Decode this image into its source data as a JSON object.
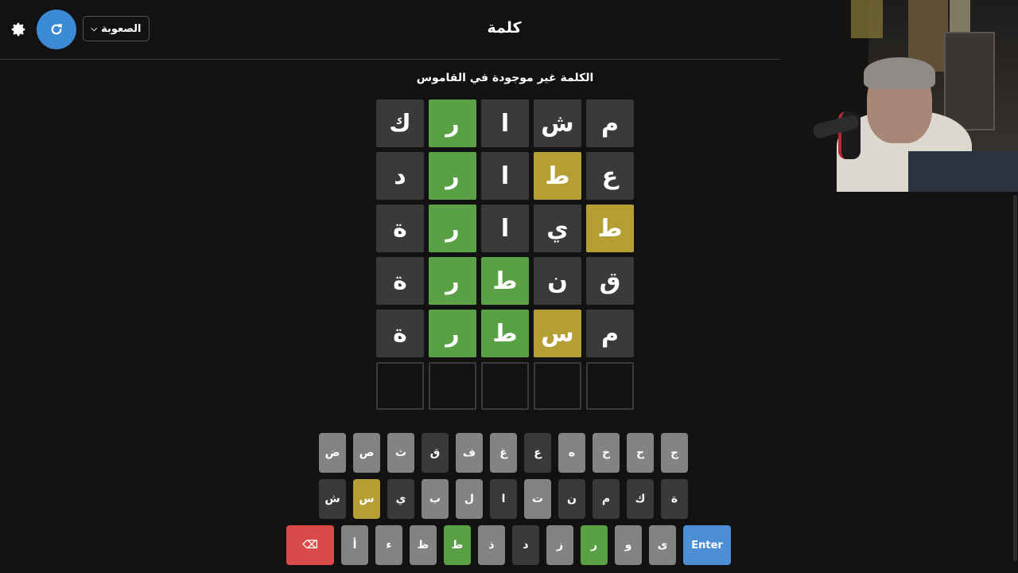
{
  "header": {
    "title": "كلمة",
    "difficulty_label": "الصعوبة",
    "settings_icon": "gear-icon",
    "refresh_icon": "refresh-icon",
    "dropdown_icon": "chevron-down-icon"
  },
  "message": "الكلمة غير موجودة في القاموس",
  "colors": {
    "background": "#121213",
    "correct": "#5aa145",
    "present": "#b59f34",
    "absent": "#3a3a3c",
    "unused_key": "#818384",
    "enter_key": "#4d8fd6",
    "backspace_key": "#d94b4b",
    "refresh_button": "#3a8ad6"
  },
  "board": {
    "rows": [
      [
        {
          "letter": "م",
          "state": "gray"
        },
        {
          "letter": "ش",
          "state": "gray"
        },
        {
          "letter": "ا",
          "state": "gray"
        },
        {
          "letter": "ر",
          "state": "green"
        },
        {
          "letter": "ك",
          "state": "gray"
        }
      ],
      [
        {
          "letter": "ع",
          "state": "gray"
        },
        {
          "letter": "ط",
          "state": "yellow"
        },
        {
          "letter": "ا",
          "state": "gray"
        },
        {
          "letter": "ر",
          "state": "green"
        },
        {
          "letter": "د",
          "state": "gray"
        }
      ],
      [
        {
          "letter": "ط",
          "state": "yellow"
        },
        {
          "letter": "ي",
          "state": "gray"
        },
        {
          "letter": "ا",
          "state": "gray"
        },
        {
          "letter": "ر",
          "state": "green"
        },
        {
          "letter": "ة",
          "state": "gray"
        }
      ],
      [
        {
          "letter": "ق",
          "state": "gray"
        },
        {
          "letter": "ن",
          "state": "gray"
        },
        {
          "letter": "ط",
          "state": "green"
        },
        {
          "letter": "ر",
          "state": "green"
        },
        {
          "letter": "ة",
          "state": "gray"
        }
      ],
      [
        {
          "letter": "م",
          "state": "gray"
        },
        {
          "letter": "س",
          "state": "yellow"
        },
        {
          "letter": "ط",
          "state": "green"
        },
        {
          "letter": "ر",
          "state": "green"
        },
        {
          "letter": "ة",
          "state": "gray"
        }
      ],
      [
        {
          "letter": "",
          "state": "empty"
        },
        {
          "letter": "",
          "state": "empty"
        },
        {
          "letter": "",
          "state": "empty"
        },
        {
          "letter": "",
          "state": "empty"
        },
        {
          "letter": "",
          "state": "empty"
        }
      ]
    ]
  },
  "keyboard": {
    "row1": [
      {
        "label": "ج",
        "state": "unused"
      },
      {
        "label": "ح",
        "state": "unused"
      },
      {
        "label": "خ",
        "state": "unused"
      },
      {
        "label": "ه",
        "state": "unused"
      },
      {
        "label": "ع",
        "state": "absent"
      },
      {
        "label": "غ",
        "state": "unused"
      },
      {
        "label": "ف",
        "state": "unused"
      },
      {
        "label": "ق",
        "state": "absent"
      },
      {
        "label": "ث",
        "state": "unused"
      },
      {
        "label": "ص",
        "state": "unused"
      },
      {
        "label": "ض",
        "state": "unused"
      }
    ],
    "row2": [
      {
        "label": "ة",
        "state": "absent"
      },
      {
        "label": "ك",
        "state": "absent"
      },
      {
        "label": "م",
        "state": "absent"
      },
      {
        "label": "ن",
        "state": "absent"
      },
      {
        "label": "ت",
        "state": "unused"
      },
      {
        "label": "ا",
        "state": "absent"
      },
      {
        "label": "ل",
        "state": "unused"
      },
      {
        "label": "ب",
        "state": "unused"
      },
      {
        "label": "ي",
        "state": "absent"
      },
      {
        "label": "س",
        "state": "yellow"
      },
      {
        "label": "ش",
        "state": "absent"
      }
    ],
    "row3": [
      {
        "label": "Enter",
        "state": "enter"
      },
      {
        "label": "ى",
        "state": "unused"
      },
      {
        "label": "و",
        "state": "unused"
      },
      {
        "label": "ر",
        "state": "green"
      },
      {
        "label": "ز",
        "state": "unused"
      },
      {
        "label": "د",
        "state": "absent"
      },
      {
        "label": "ذ",
        "state": "unused"
      },
      {
        "label": "ط",
        "state": "green"
      },
      {
        "label": "ظ",
        "state": "unused"
      },
      {
        "label": "ء",
        "state": "unused"
      },
      {
        "label": "أ",
        "state": "unused"
      },
      {
        "label": "⌫",
        "state": "back"
      }
    ]
  }
}
